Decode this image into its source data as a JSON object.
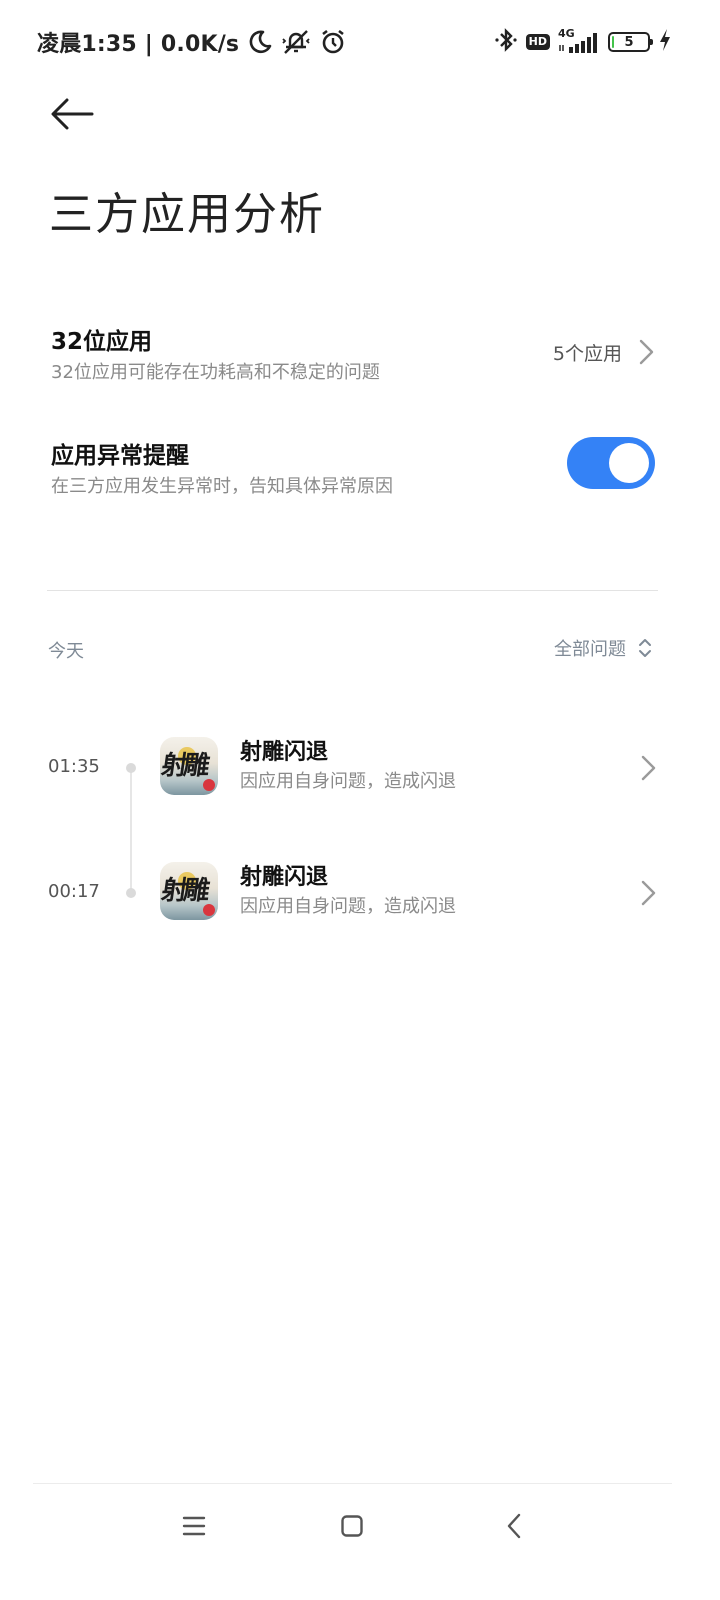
{
  "status_bar": {
    "time_text": "凌晨1:35 | 0.0K/s",
    "network_type": "4G",
    "hd_label": "HD",
    "battery_level": "5",
    "battery_fraction": 0.05,
    "icons": [
      "moon-icon",
      "mute-vibrate-icon",
      "alarm-icon",
      "bluetooth-icon",
      "hd-icon",
      "signal-icon",
      "battery-icon",
      "charging-icon"
    ]
  },
  "header": {
    "back_icon": "back-arrow-icon",
    "title": "三方应用分析"
  },
  "settings": {
    "apps32": {
      "title": "32位应用",
      "subtitle": "32位应用可能存在功耗高和不稳定的问题",
      "value": "5个应用"
    },
    "crash_alert": {
      "title": "应用异常提醒",
      "subtitle": "在三方应用发生异常时，告知具体异常原因",
      "enabled": true
    }
  },
  "section": {
    "label": "今天",
    "filter_label": "全部问题"
  },
  "events": [
    {
      "time": "01:35",
      "title": "射雕闪退",
      "description": "因应用自身问题，造成闪退",
      "icon_text": "射雕"
    },
    {
      "time": "00:17",
      "title": "射雕闪退",
      "description": "因应用自身问题，造成闪退",
      "icon_text": "射雕"
    }
  ],
  "colors": {
    "accent": "#3482f6",
    "battery_fill": "#43c34a",
    "secondary_text": "#8a8a8a"
  },
  "nav_bar": {
    "icons": [
      "menu-icon",
      "home-icon",
      "back-icon"
    ]
  }
}
